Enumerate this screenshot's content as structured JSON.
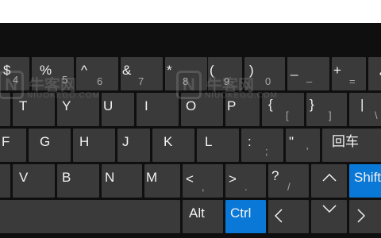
{
  "watermark": {
    "logo_letter": "N",
    "cn": "牛客网",
    "en": "NIUOKEGO.COM"
  },
  "rows": {
    "numbers": [
      {
        "id": "4",
        "primary": "$",
        "secondary": "4"
      },
      {
        "id": "5",
        "primary": "%",
        "secondary": "5"
      },
      {
        "id": "6",
        "primary": "^",
        "secondary": "6"
      },
      {
        "id": "7",
        "primary": "&",
        "secondary": "7"
      },
      {
        "id": "8",
        "primary": "*",
        "secondary": "8"
      },
      {
        "id": "9",
        "primary": "(",
        "secondary": "9"
      },
      {
        "id": "0",
        "primary": ")",
        "secondary": "0"
      },
      {
        "id": "minus",
        "primary": "_",
        "secondary": "–"
      },
      {
        "id": "equals",
        "primary": "+",
        "secondary": "="
      }
    ],
    "top": [
      {
        "id": "t",
        "label": "T"
      },
      {
        "id": "y",
        "label": "Y"
      },
      {
        "id": "u",
        "label": "U"
      },
      {
        "id": "i",
        "label": "I"
      },
      {
        "id": "o",
        "label": "O"
      },
      {
        "id": "p",
        "label": "P"
      },
      {
        "id": "lbracket",
        "primary": "{",
        "secondary": "["
      },
      {
        "id": "rbracket",
        "primary": "}",
        "secondary": "]"
      },
      {
        "id": "backslash",
        "primary": "|",
        "secondary": "\\"
      }
    ],
    "home": [
      {
        "id": "f",
        "label": "F"
      },
      {
        "id": "g",
        "label": "G"
      },
      {
        "id": "h",
        "label": "H"
      },
      {
        "id": "j",
        "label": "J"
      },
      {
        "id": "k",
        "label": "K"
      },
      {
        "id": "l",
        "label": "L"
      },
      {
        "id": "semicolon",
        "primary": ":",
        "secondary": ";"
      },
      {
        "id": "quote",
        "primary": "\"",
        "secondary": "'"
      }
    ],
    "bottom": [
      {
        "id": "v",
        "label": "V"
      },
      {
        "id": "b",
        "label": "B"
      },
      {
        "id": "n",
        "label": "N"
      },
      {
        "id": "m",
        "label": "M"
      },
      {
        "id": "comma",
        "primary": "<",
        "secondary": ","
      },
      {
        "id": "period",
        "primary": ">",
        "secondary": "."
      },
      {
        "id": "slash",
        "primary": "?",
        "secondary": "/"
      }
    ]
  },
  "keys": {
    "enter_label": "回车",
    "shift_label": "Shift",
    "alt_label": "Alt",
    "ctrl_label": "Ctrl"
  },
  "icons": {
    "backspace": "backspace-icon",
    "up": "arrow-up-icon",
    "left": "arrow-left-icon",
    "down": "arrow-down-icon",
    "right": "arrow-right-icon"
  },
  "colors": {
    "keyboard_bg": "#0f0f0f",
    "key_bg": "#3a3a3a",
    "accent": "#0a78d7",
    "key_text": "#f2f2f2",
    "secondary_text": "#a8a8a8"
  }
}
